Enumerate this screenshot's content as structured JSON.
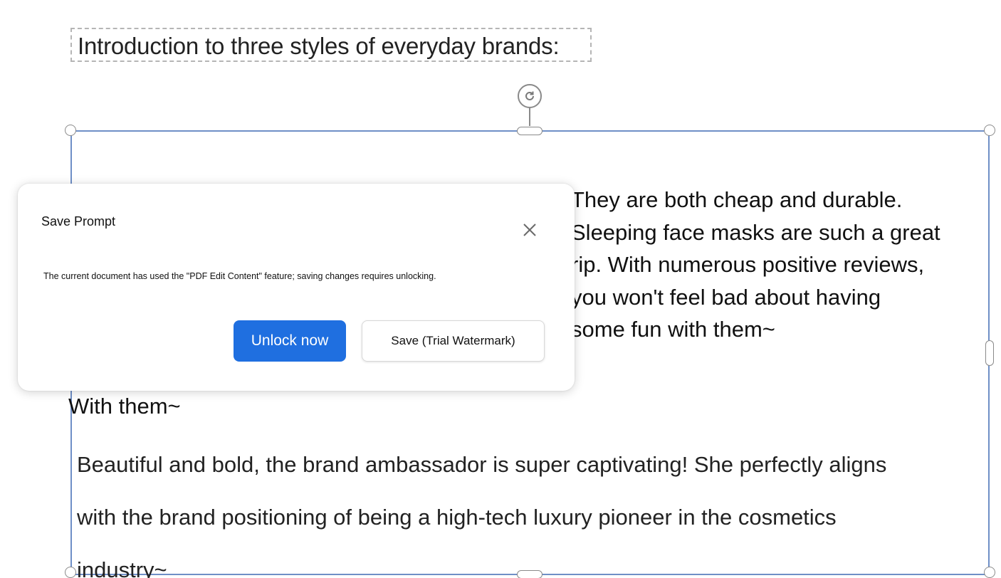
{
  "document": {
    "heading": "Introduction to three styles of everyday brands:",
    "right_paragraph_lines": [
      "They are both cheap and durable.",
      "Sleeping face masks are such a great",
      "rip. With numerous positive reviews,",
      "you won't feel bad about having",
      "some fun with them~"
    ],
    "with_them": "With them~",
    "bottom_paragraph_lines": [
      "Beautiful and bold, the brand ambassador is super captivating! She perfectly aligns",
      "with the brand positioning of being a high-tech luxury pioneer in the cosmetics",
      "industry~"
    ]
  },
  "dialog": {
    "title": "Save Prompt",
    "message": "The current document has used the \"PDF Edit Content\" feature; saving changes requires unlocking.",
    "primary_button": "Unlock now",
    "secondary_button": "Save (Trial Watermark)",
    "close_icon": "close-icon"
  },
  "colors": {
    "accent": "#1f6fe0",
    "selection_border": "#6f8fc7",
    "handle_border": "#8a8a8a"
  }
}
